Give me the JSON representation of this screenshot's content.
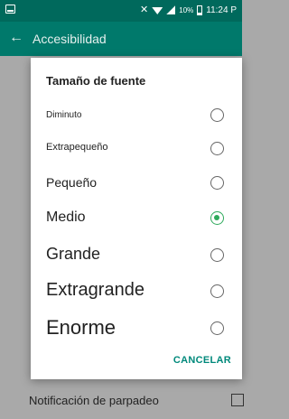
{
  "status_bar": {
    "battery": "10%",
    "time": "11:24 P",
    "icons": [
      "notification-icon",
      "mute-icon",
      "wifi-icon",
      "signal-icon",
      "battery-icon"
    ]
  },
  "app_bar": {
    "back_icon": "arrow-back-icon",
    "title": "Accesibilidad"
  },
  "dialog": {
    "title": "Tamaño de fuente",
    "options": [
      {
        "label": "Diminuto",
        "selected": false
      },
      {
        "label": "Extrapequeño",
        "selected": false
      },
      {
        "label": "Pequeño",
        "selected": false
      },
      {
        "label": "Medio",
        "selected": true
      },
      {
        "label": "Grande",
        "selected": false
      },
      {
        "label": "Extragrande",
        "selected": false
      },
      {
        "label": "Enorme",
        "selected": false
      }
    ],
    "cancel_label": "CANCELAR"
  },
  "background": {
    "setting_label": "Notificación de parpadeo"
  },
  "colors": {
    "status_bar": "#00695c",
    "app_bar": "#00796b",
    "accent": "#2eaa5b",
    "cancel_text": "#00897b"
  }
}
